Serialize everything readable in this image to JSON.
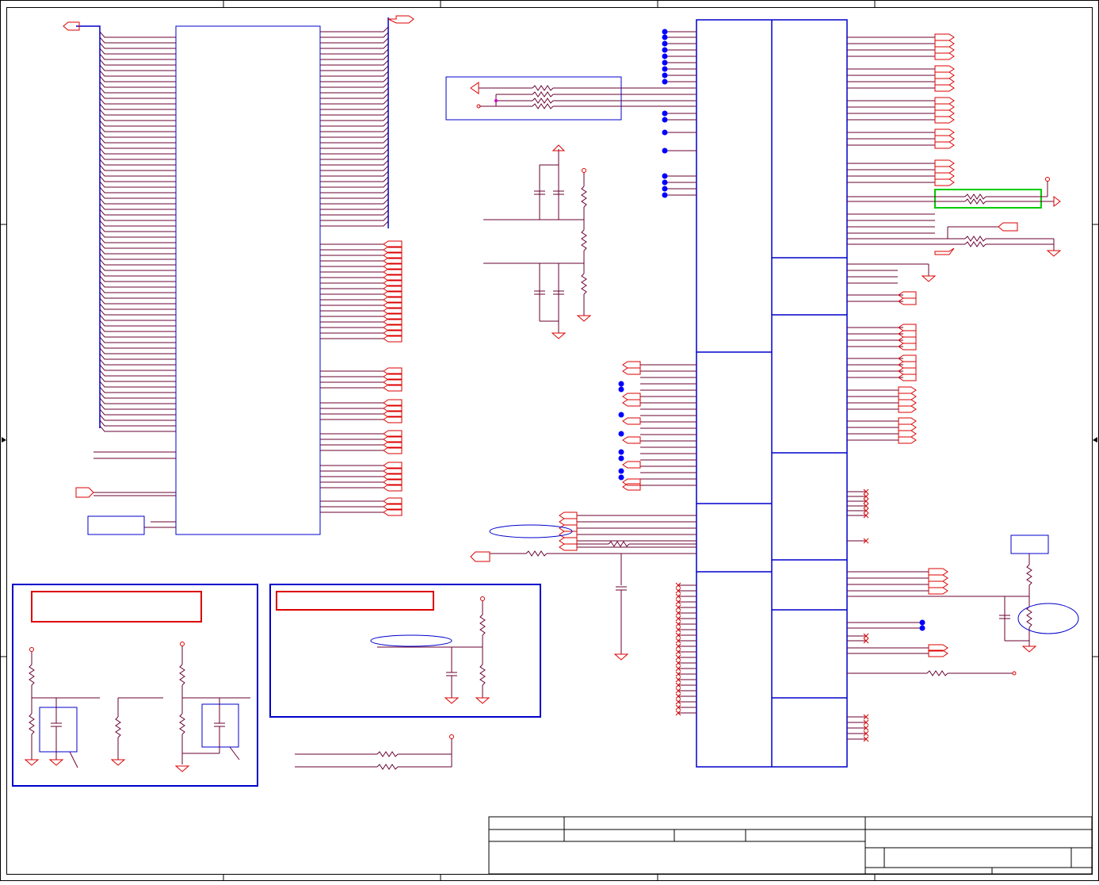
{
  "sheet": {
    "background": "#ffffff",
    "colors": {
      "frame": "#000000",
      "component": "#0000cc",
      "wire": "#6a0032",
      "net_label": "#dd0000",
      "junction": "#0000ff",
      "highlight": "#00cc00",
      "note_box": "#dd0000",
      "pin_end": "#cc00cc"
    },
    "components": [
      "main-connector",
      "bridge-chip",
      "resistor-network",
      "voltage-divider",
      "level-shift-network",
      "title-block"
    ]
  }
}
